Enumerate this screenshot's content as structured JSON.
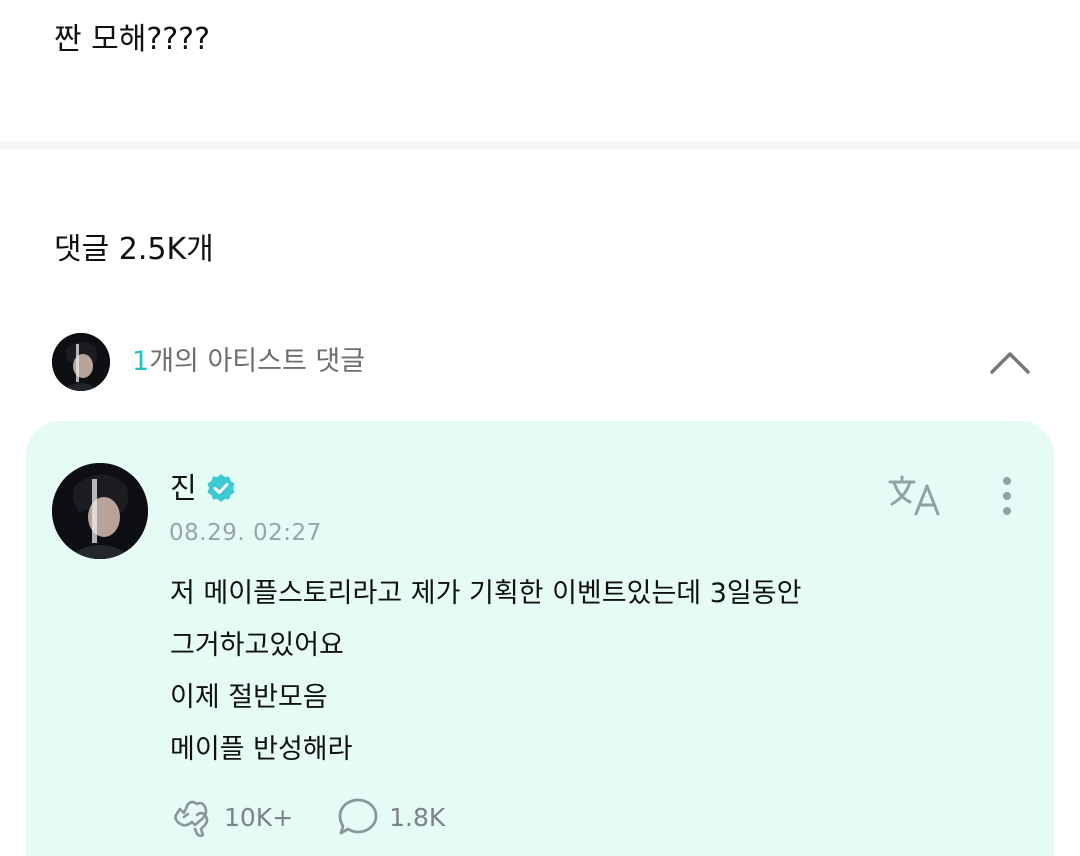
{
  "post": {
    "text": "짠 모해????"
  },
  "comments": {
    "count_label": "댓글 2.5K개"
  },
  "artist_comments": {
    "count": "1",
    "label": "개의 아티스트 댓글"
  },
  "comment": {
    "author": "진",
    "timestamp": "08.29. 02:27",
    "lines": [
      "저 메이플스토리라고 제가 기획한 이벤트있는데 3일동안",
      "그거하고있어요",
      "이제 절반모음",
      "메이플 반성해라"
    ],
    "likes": "10K+",
    "replies": "1.8K"
  },
  "icons": {
    "verified": "verified-badge-icon",
    "translate": "translate-icon",
    "more": "more-vertical-icon",
    "collapse": "chevron-up-icon",
    "like": "heart-hand-icon",
    "reply": "speech-bubble-icon"
  },
  "colors": {
    "accent": "#25c2c7",
    "card_background": "#e6fbf6",
    "muted_text": "#9aa3a6"
  }
}
